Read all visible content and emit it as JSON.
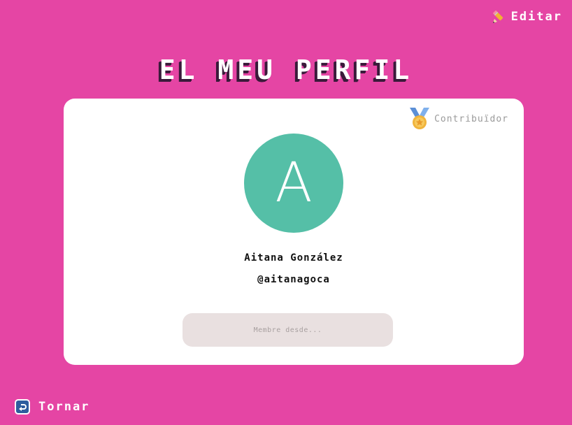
{
  "header": {
    "edit_label": "Editar",
    "edit_icon": "pencil-icon"
  },
  "page": {
    "title": "EL MEU PERFIL"
  },
  "profile": {
    "badge_label": "Contribuïdor",
    "badge_icon": "medal-icon",
    "avatar_initial": "A",
    "full_name": "Aitana González",
    "username": "@aitanagoca",
    "member_since_placeholder": "Membre desde...",
    "avatar_color": "#55bfa7"
  },
  "footer": {
    "back_label": "Tornar",
    "back_icon": "return-icon"
  },
  "colors": {
    "background": "#e545a4",
    "card": "#ffffff",
    "field": "#e9e0e0"
  }
}
